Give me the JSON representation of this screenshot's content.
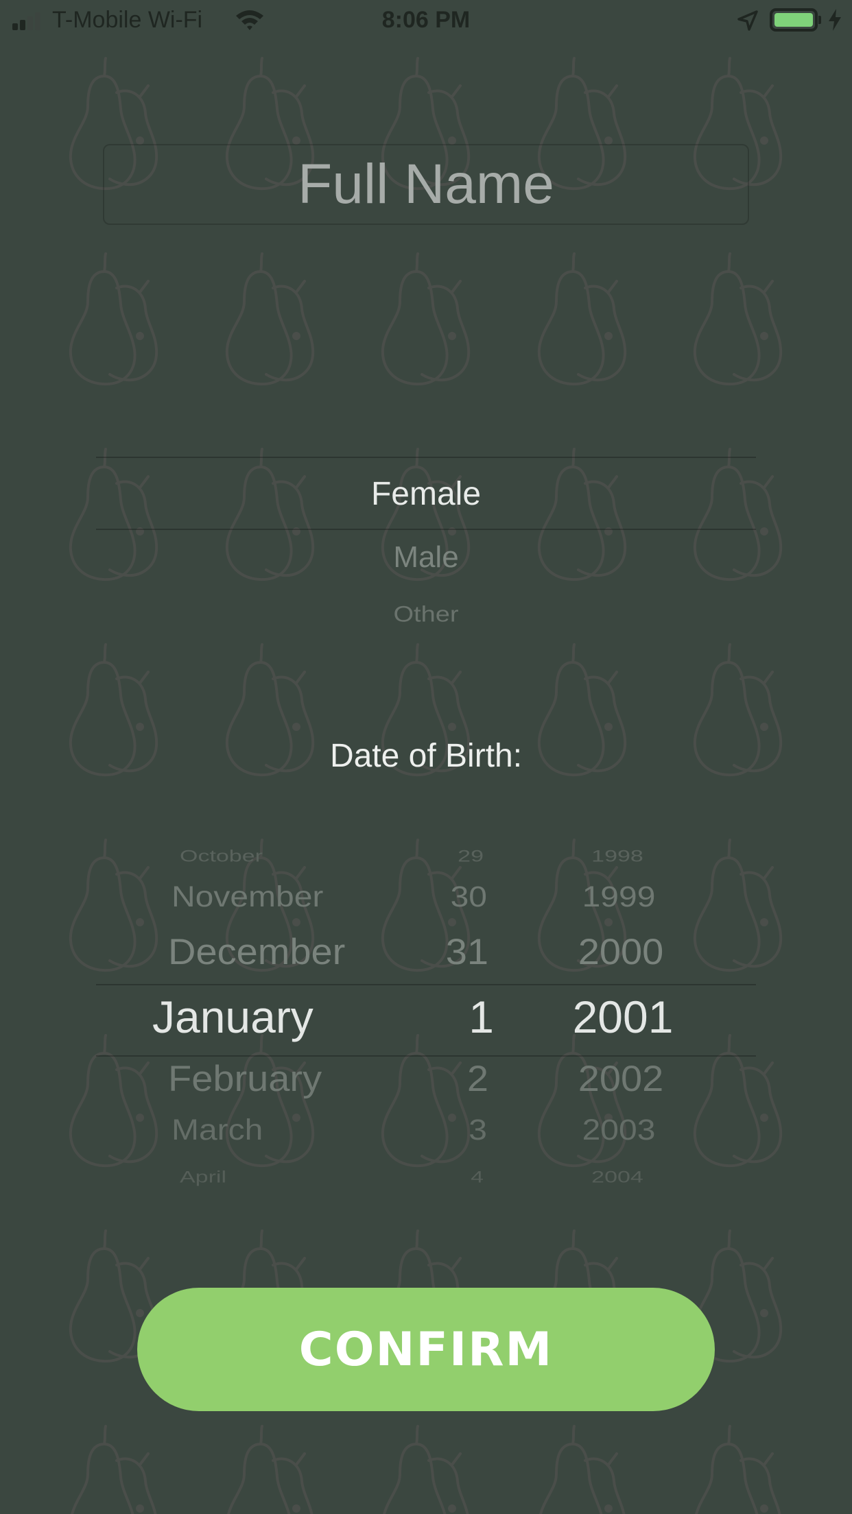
{
  "status_bar": {
    "carrier": "T-Mobile Wi-Fi",
    "time": "8:06 PM",
    "icons": [
      "signal-icon",
      "wifi-icon",
      "location-arrow-icon",
      "battery-icon",
      "charging-bolt-icon"
    ],
    "battery_color": "#7fd37a"
  },
  "form": {
    "name_placeholder": "Full Name",
    "gender_options": [
      "Female",
      "Male",
      "Other"
    ],
    "gender_selected": "Female",
    "dob_label": "Date of Birth:",
    "date_picker": {
      "months": [
        "October",
        "November",
        "December",
        "January",
        "February",
        "March",
        "April"
      ],
      "days": [
        "29",
        "30",
        "31",
        "1",
        "2",
        "3",
        "4"
      ],
      "years": [
        "1998",
        "1999",
        "2000",
        "2001",
        "2002",
        "2003",
        "2004"
      ],
      "selected": {
        "month": "January",
        "day": "1",
        "year": "2001"
      }
    },
    "confirm_label": "CONFIRM"
  },
  "colors": {
    "background": "#3b4740",
    "accent": "#92cf6d",
    "pear_outline": "#4a4e4a"
  },
  "background_pattern_icon": "pear-icon"
}
